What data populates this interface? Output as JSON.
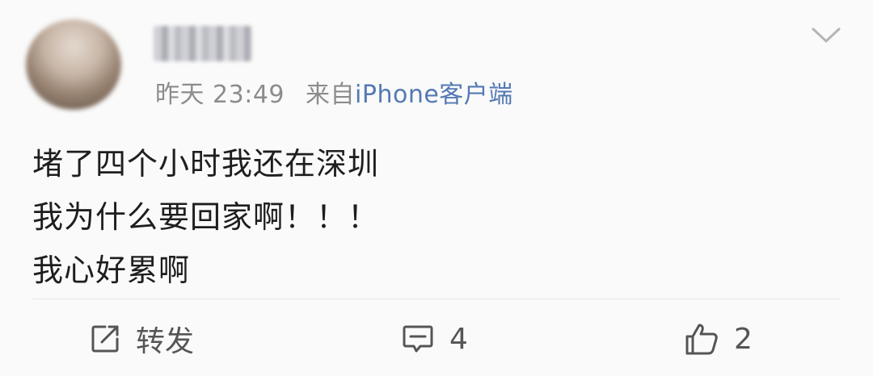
{
  "post": {
    "username": "",
    "time": "昨天 23:49",
    "source_prefix": "来自",
    "source_app": "iPhone客户端",
    "content_lines": [
      "堵了四个小时我还在深圳",
      "我为什么要回家啊！！！",
      "我心好累啊"
    ]
  },
  "actions": {
    "repost_label": "转发",
    "comment_count": "4",
    "like_count": "2"
  },
  "icons": {
    "menu": "chevron-down-icon",
    "repost": "share-icon",
    "comment": "comment-icon",
    "like": "thumbs-up-icon"
  },
  "colors": {
    "background": "#fafafa",
    "text_primary": "#1e1e1e",
    "text_secondary": "#8c8c8c",
    "icon": "#555555",
    "source_link": "#5479b3"
  }
}
